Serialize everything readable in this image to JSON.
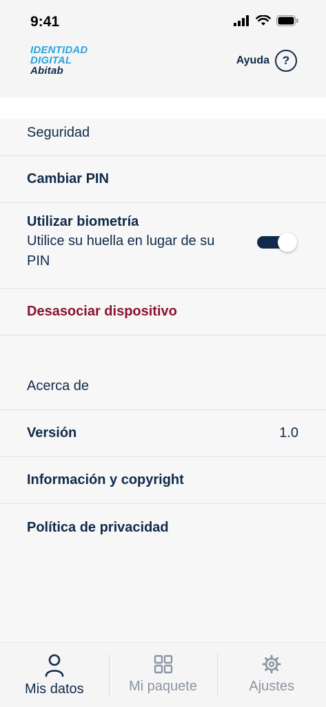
{
  "status_bar": {
    "time": "9:41"
  },
  "header": {
    "logo_line1": "IDENTIDAD",
    "logo_line2": "DIGITAL",
    "logo_line3": "Abitab",
    "help_label": "Ayuda",
    "help_icon_glyph": "?"
  },
  "security": {
    "title": "Seguridad",
    "change_pin": "Cambiar PIN",
    "biometrics_label": "Utilizar biometría",
    "biometrics_description": "Utilice su huella en lugar de su PIN",
    "biometrics_enabled": true,
    "dissociate_device": "Desasociar dispositivo"
  },
  "about": {
    "title": "Acerca de",
    "version_label": "Versión",
    "version_value": "1.0",
    "info_copyright": "Información y copyright",
    "privacy_policy": "Política de privacidad"
  },
  "tabbar": {
    "tabs": [
      {
        "label": "Mis datos",
        "icon": "user-icon",
        "active": true
      },
      {
        "label": "Mi paquete",
        "icon": "grid-icon",
        "active": false
      },
      {
        "label": "Ajustes",
        "icon": "gear-icon",
        "active": false
      }
    ]
  },
  "colors": {
    "primary": "#0f2a4a",
    "accent_blue": "#2aa3df",
    "danger": "#8a1230",
    "inactive": "#8b95a3"
  }
}
